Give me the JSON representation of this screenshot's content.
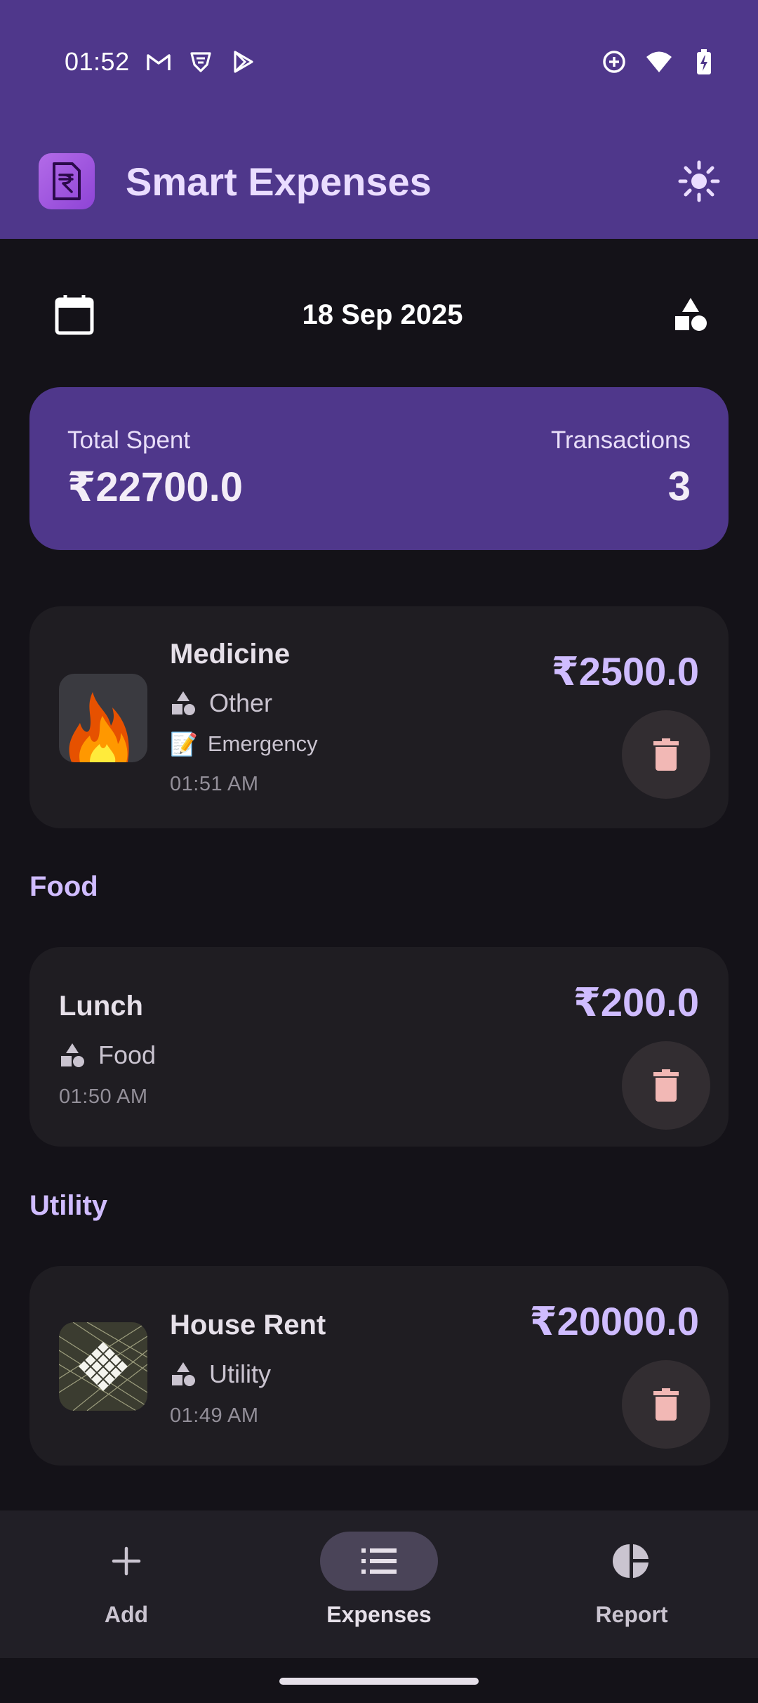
{
  "status_bar": {
    "time": "01:52",
    "left_icons": [
      "gmail-icon",
      "vpn-shield-icon",
      "play-store-icon"
    ],
    "right_icons": [
      "data-saver-icon",
      "wifi-icon",
      "battery-charging-icon"
    ]
  },
  "app_bar": {
    "title": "Smart Expenses",
    "logo_icon": "receipt-rupee-icon",
    "action_icon": "light-mode-icon"
  },
  "date_row": {
    "date": "18 Sep 2025",
    "left_icon": "calendar-icon",
    "right_icon": "category-icon"
  },
  "summary": {
    "total_label": "Total Spent",
    "total_value": "₹22700.0",
    "count_label": "Transactions",
    "count_value": "3"
  },
  "sections": [
    {
      "title": "",
      "items": [
        {
          "name": "Medicine",
          "category": "Other",
          "note_emoji": "📝",
          "note": "Emergency",
          "time": "01:51 AM",
          "amount": "₹2500.0",
          "thumb": "fire-image"
        }
      ]
    },
    {
      "title": "Food",
      "items": [
        {
          "name": "Lunch",
          "category": "Food",
          "time": "01:50 AM",
          "amount": "₹200.0"
        }
      ]
    },
    {
      "title": "Utility",
      "items": [
        {
          "name": "House Rent",
          "category": "Utility",
          "time": "01:49 AM",
          "amount": "₹20000.0",
          "thumb": "abstract-grid-image"
        }
      ]
    }
  ],
  "bottom_nav": [
    {
      "label": "Add",
      "icon": "plus-icon",
      "active": false
    },
    {
      "label": "Expenses",
      "icon": "list-icon",
      "active": true
    },
    {
      "label": "Report",
      "icon": "pie-chart-icon",
      "active": false
    }
  ],
  "colors": {
    "primary": "#4F378B",
    "background": "#141218",
    "card": "#1F1D22",
    "amount": "#CFBCFF",
    "delete_icon": "#F2B8B5"
  }
}
